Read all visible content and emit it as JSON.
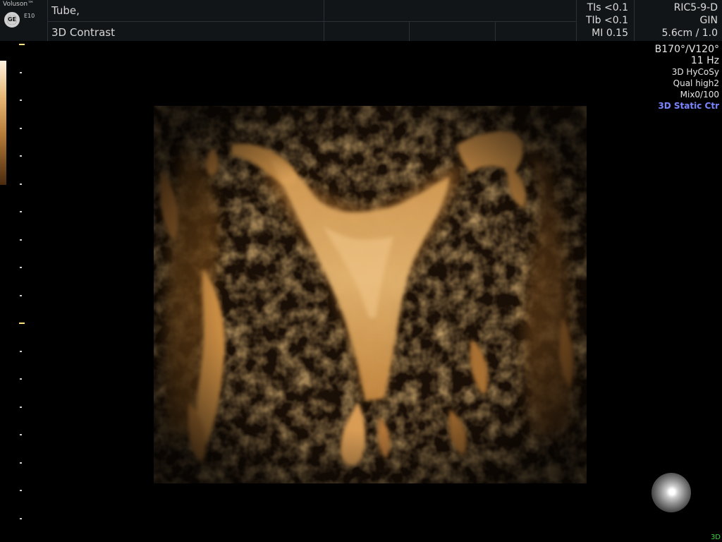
{
  "header": {
    "brand": "Voluson™",
    "model": "E10",
    "logo_text": "GE",
    "exam_line1": "Tube,",
    "exam_line2": "3D Contrast",
    "safety": {
      "tis": "TIs <0.1",
      "tib": "TIb <0.1",
      "mi": "MI 0.15"
    },
    "probe": {
      "name": "RIC5-9-D",
      "preset": "GIN",
      "depth": "5.6cm / 1.0"
    }
  },
  "params": [
    "B170°/V120°",
    "11 Hz",
    "3D HyCoSy",
    "Qual high2",
    "Mix0/100",
    "3D Static Ctr"
  ],
  "mode_indicator": "3D",
  "colors": {
    "background": "#000000",
    "header": "#121518",
    "render_tint": "#c78a3e",
    "mode_text": "#7a86ff",
    "indicator": "#3fd43f"
  },
  "icons": {
    "orientation": "orientation-sphere-icon",
    "logo": "ge-logo-icon"
  }
}
